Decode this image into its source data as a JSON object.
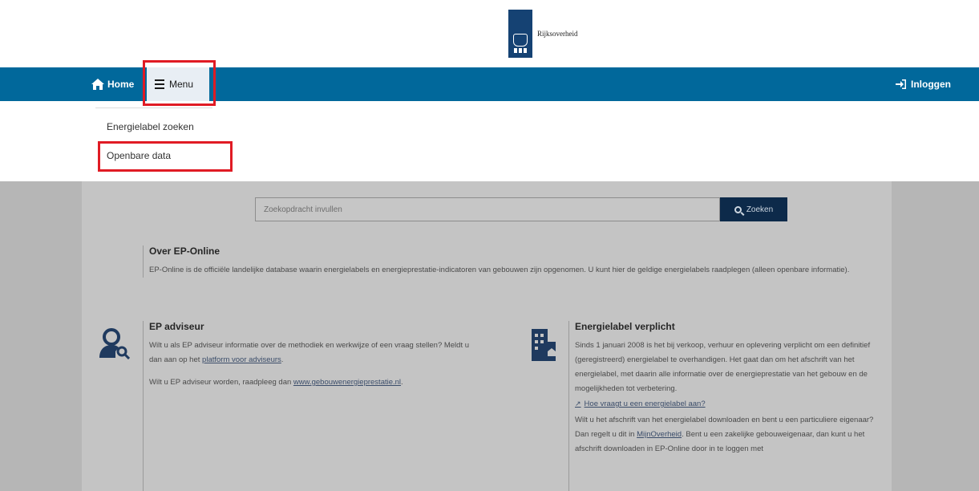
{
  "header": {
    "logo_text": "Rijksoverheid"
  },
  "nav": {
    "home_label": "Home",
    "menu_label": "Menu",
    "login_label": "Inloggen"
  },
  "dropdown": {
    "items": [
      {
        "label": "Energielabel zoeken"
      },
      {
        "label": "Openbare data"
      }
    ]
  },
  "search": {
    "placeholder": "Zoekopdracht invullen",
    "button_label": "Zoeken"
  },
  "over": {
    "title": "Over EP-Online",
    "text": "EP-Online is de officiële landelijke database waarin energielabels en energieprestatie-indicatoren van gebouwen zijn opgenomen. U kunt hier de geldige energielabels raadplegen (alleen openbare informatie)."
  },
  "adviseur": {
    "title": "EP adviseur",
    "p1_before": "Wilt u als EP adviseur informatie over de methodiek en werkwijze of een vraag stellen? Meldt u dan aan op het ",
    "p1_link": "platform voor adviseurs",
    "p1_after": ".",
    "p2_before": "Wilt u EP adviseur worden, raadpleeg dan ",
    "p2_link": "www.gebouwenergieprestatie.nl",
    "p2_after": "."
  },
  "verplicht": {
    "title": "Energielabel verplicht",
    "p1": "Sinds 1 januari 2008 is het bij verkoop, verhuur en oplevering verplicht om een definitief (geregistreerd) energielabel te overhandigen. Het gaat dan om het afschrift van het energielabel, met daarin alle informatie over de energieprestatie van het gebouw en de mogelijkheden tot verbetering.",
    "link_label": "Hoe vraagt u een energielabel aan?",
    "p2_before": "Wilt u het afschrift van het energielabel downloaden en bent u een particuliere eigenaar? Dan regelt u dit in ",
    "p2_link": "MijnOverheid",
    "p2_after": ". Bent u een zakelijke gebouweigenaar, dan kunt u het afschrift downloaden in EP-Online door in te loggen met"
  },
  "colors": {
    "nav_blue": "#01689b",
    "highlight_red": "#e01b24",
    "search_button": "#0d2a4a"
  }
}
